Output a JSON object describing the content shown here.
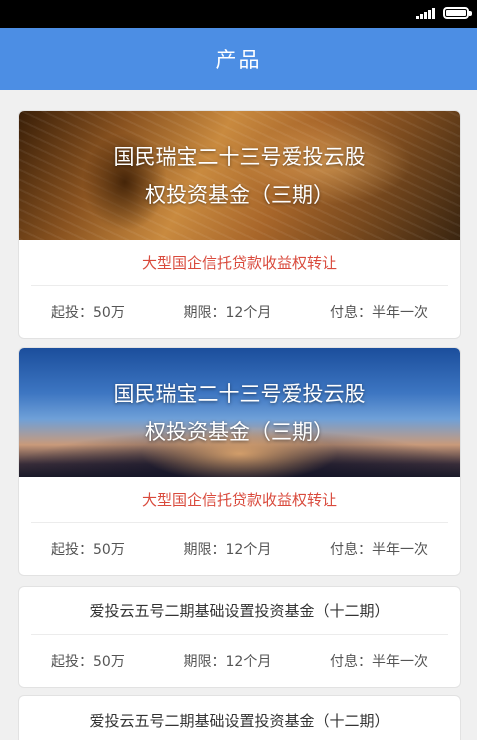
{
  "status_bar": {
    "battery_level": 1.0
  },
  "header": {
    "title": "产品"
  },
  "products": [
    {
      "banner_line1": "国民瑞宝二十三号爱投云股",
      "banner_line2": "权投资基金（三期）",
      "subtitle": "大型国企信托贷款收益权转让",
      "min_invest": "起投：50万",
      "term": "期限：12个月",
      "interest": "付息：半年一次"
    },
    {
      "banner_line1": "国民瑞宝二十三号爱投云股",
      "banner_line2": "权投资基金（三期）",
      "subtitle": "大型国企信托贷款收益权转让",
      "min_invest": "起投：50万",
      "term": "期限：12个月",
      "interest": "付息：半年一次"
    },
    {
      "title": "爱投云五号二期基础设置投资基金（十二期）",
      "min_invest": "起投：50万",
      "term": "期限：12个月",
      "interest": "付息：半年一次"
    },
    {
      "title": "爱投云五号二期基础设置投资基金（十二期）"
    }
  ]
}
